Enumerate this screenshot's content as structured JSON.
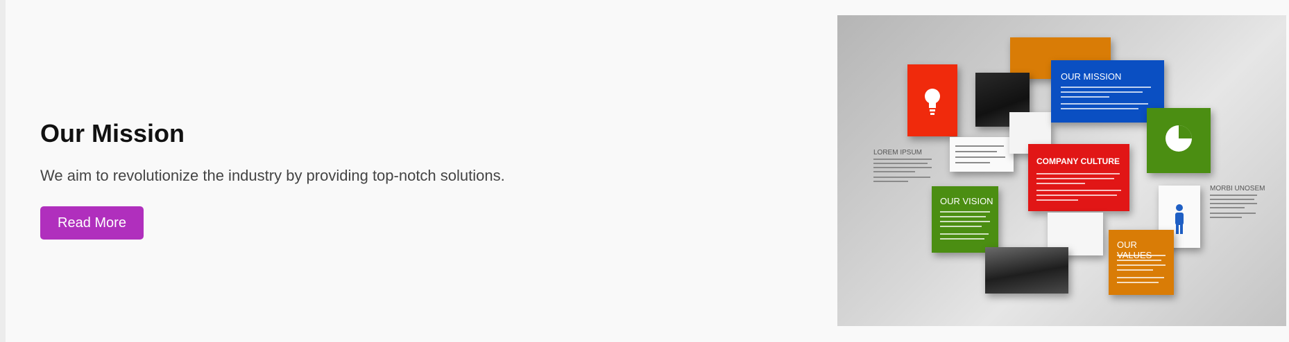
{
  "section": {
    "title": "Our Mission",
    "description": "We aim to revolutionize the industry by providing top-notch solutions.",
    "button_label": "Read More",
    "button_color": "#b02fbd"
  },
  "image": {
    "card_labels": {
      "mission": "OUR MISSION",
      "culture": "COMPANY CULTURE",
      "vision": "OUR VISION",
      "values": "OUR VALUES",
      "side_left": "LOREM IPSUM",
      "side_right": "MORBI UNOSEM"
    },
    "colors": {
      "orange": "#d97c06",
      "blue": "#0a4fc2",
      "red": "#e11616",
      "green": "#4b8e12",
      "bright_red": "#f02a0c"
    },
    "icons": [
      "lightbulb-icon",
      "pie-chart-icon",
      "person-icon"
    ]
  }
}
